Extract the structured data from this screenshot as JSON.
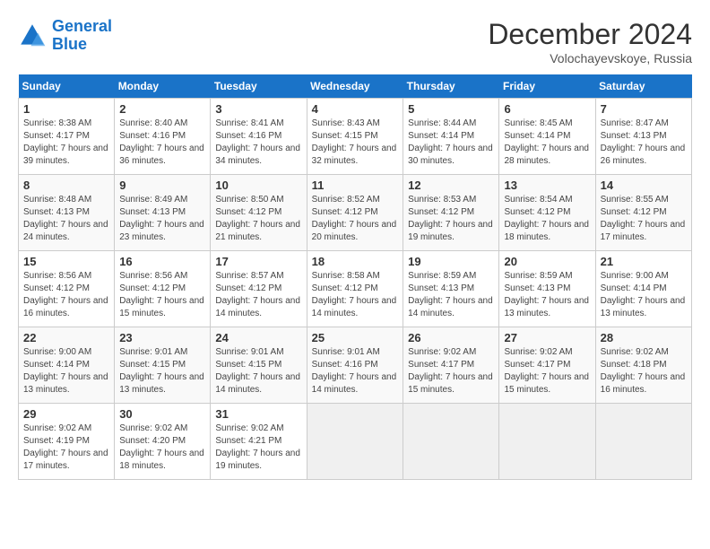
{
  "header": {
    "logo_line1": "General",
    "logo_line2": "Blue",
    "month": "December 2024",
    "location": "Volochayevskoye, Russia"
  },
  "weekdays": [
    "Sunday",
    "Monday",
    "Tuesday",
    "Wednesday",
    "Thursday",
    "Friday",
    "Saturday"
  ],
  "weeks": [
    [
      {
        "day": "1",
        "info": "Sunrise: 8:38 AM\nSunset: 4:17 PM\nDaylight: 7 hours and 39 minutes."
      },
      {
        "day": "2",
        "info": "Sunrise: 8:40 AM\nSunset: 4:16 PM\nDaylight: 7 hours and 36 minutes."
      },
      {
        "day": "3",
        "info": "Sunrise: 8:41 AM\nSunset: 4:16 PM\nDaylight: 7 hours and 34 minutes."
      },
      {
        "day": "4",
        "info": "Sunrise: 8:43 AM\nSunset: 4:15 PM\nDaylight: 7 hours and 32 minutes."
      },
      {
        "day": "5",
        "info": "Sunrise: 8:44 AM\nSunset: 4:14 PM\nDaylight: 7 hours and 30 minutes."
      },
      {
        "day": "6",
        "info": "Sunrise: 8:45 AM\nSunset: 4:14 PM\nDaylight: 7 hours and 28 minutes."
      },
      {
        "day": "7",
        "info": "Sunrise: 8:47 AM\nSunset: 4:13 PM\nDaylight: 7 hours and 26 minutes."
      }
    ],
    [
      {
        "day": "8",
        "info": "Sunrise: 8:48 AM\nSunset: 4:13 PM\nDaylight: 7 hours and 24 minutes."
      },
      {
        "day": "9",
        "info": "Sunrise: 8:49 AM\nSunset: 4:13 PM\nDaylight: 7 hours and 23 minutes."
      },
      {
        "day": "10",
        "info": "Sunrise: 8:50 AM\nSunset: 4:12 PM\nDaylight: 7 hours and 21 minutes."
      },
      {
        "day": "11",
        "info": "Sunrise: 8:52 AM\nSunset: 4:12 PM\nDaylight: 7 hours and 20 minutes."
      },
      {
        "day": "12",
        "info": "Sunrise: 8:53 AM\nSunset: 4:12 PM\nDaylight: 7 hours and 19 minutes."
      },
      {
        "day": "13",
        "info": "Sunrise: 8:54 AM\nSunset: 4:12 PM\nDaylight: 7 hours and 18 minutes."
      },
      {
        "day": "14",
        "info": "Sunrise: 8:55 AM\nSunset: 4:12 PM\nDaylight: 7 hours and 17 minutes."
      }
    ],
    [
      {
        "day": "15",
        "info": "Sunrise: 8:56 AM\nSunset: 4:12 PM\nDaylight: 7 hours and 16 minutes."
      },
      {
        "day": "16",
        "info": "Sunrise: 8:56 AM\nSunset: 4:12 PM\nDaylight: 7 hours and 15 minutes."
      },
      {
        "day": "17",
        "info": "Sunrise: 8:57 AM\nSunset: 4:12 PM\nDaylight: 7 hours and 14 minutes."
      },
      {
        "day": "18",
        "info": "Sunrise: 8:58 AM\nSunset: 4:12 PM\nDaylight: 7 hours and 14 minutes."
      },
      {
        "day": "19",
        "info": "Sunrise: 8:59 AM\nSunset: 4:13 PM\nDaylight: 7 hours and 14 minutes."
      },
      {
        "day": "20",
        "info": "Sunrise: 8:59 AM\nSunset: 4:13 PM\nDaylight: 7 hours and 13 minutes."
      },
      {
        "day": "21",
        "info": "Sunrise: 9:00 AM\nSunset: 4:14 PM\nDaylight: 7 hours and 13 minutes."
      }
    ],
    [
      {
        "day": "22",
        "info": "Sunrise: 9:00 AM\nSunset: 4:14 PM\nDaylight: 7 hours and 13 minutes."
      },
      {
        "day": "23",
        "info": "Sunrise: 9:01 AM\nSunset: 4:15 PM\nDaylight: 7 hours and 13 minutes."
      },
      {
        "day": "24",
        "info": "Sunrise: 9:01 AM\nSunset: 4:15 PM\nDaylight: 7 hours and 14 minutes."
      },
      {
        "day": "25",
        "info": "Sunrise: 9:01 AM\nSunset: 4:16 PM\nDaylight: 7 hours and 14 minutes."
      },
      {
        "day": "26",
        "info": "Sunrise: 9:02 AM\nSunset: 4:17 PM\nDaylight: 7 hours and 15 minutes."
      },
      {
        "day": "27",
        "info": "Sunrise: 9:02 AM\nSunset: 4:17 PM\nDaylight: 7 hours and 15 minutes."
      },
      {
        "day": "28",
        "info": "Sunrise: 9:02 AM\nSunset: 4:18 PM\nDaylight: 7 hours and 16 minutes."
      }
    ],
    [
      {
        "day": "29",
        "info": "Sunrise: 9:02 AM\nSunset: 4:19 PM\nDaylight: 7 hours and 17 minutes."
      },
      {
        "day": "30",
        "info": "Sunrise: 9:02 AM\nSunset: 4:20 PM\nDaylight: 7 hours and 18 minutes."
      },
      {
        "day": "31",
        "info": "Sunrise: 9:02 AM\nSunset: 4:21 PM\nDaylight: 7 hours and 19 minutes."
      },
      null,
      null,
      null,
      null
    ]
  ]
}
